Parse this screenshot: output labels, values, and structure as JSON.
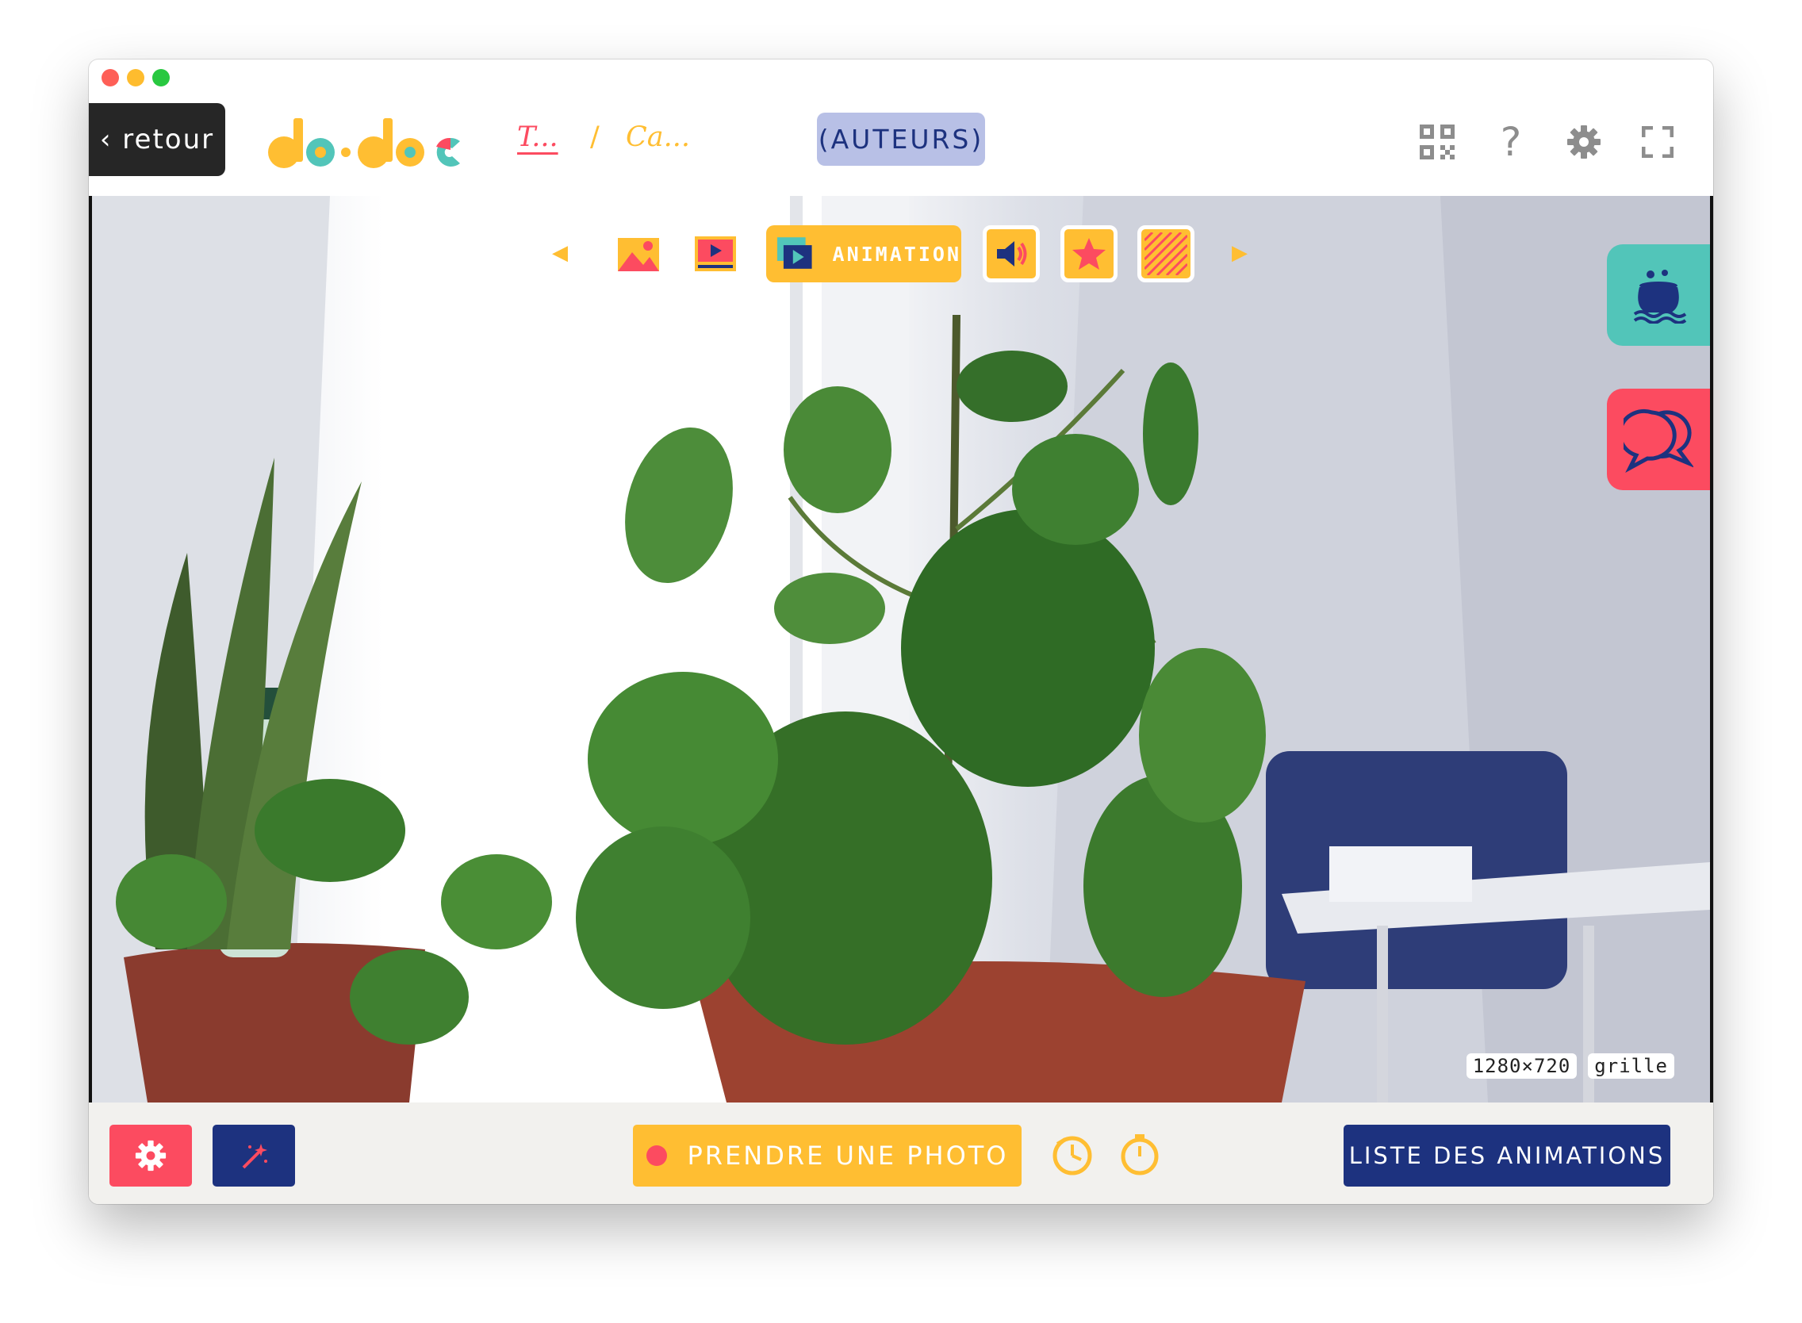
{
  "window": {
    "controls": [
      "close",
      "minimize",
      "zoom"
    ]
  },
  "header": {
    "back_label": "‹ retour",
    "logo_alt": "do•doc",
    "breadcrumb": {
      "project": "T...",
      "separator": "/",
      "module": "Ca..."
    },
    "authors_label": "(AUTEURS)",
    "icons": [
      "qr-code-icon",
      "help-icon",
      "settings-icon",
      "fullscreen-icon"
    ],
    "help_glyph": "?"
  },
  "capture": {
    "modes": [
      {
        "name": "photo",
        "icon": "image-icon"
      },
      {
        "name": "video",
        "icon": "video-icon"
      },
      {
        "name": "animation",
        "label": "ANIMATION",
        "icon": "animation-icon",
        "active": true
      },
      {
        "name": "audio",
        "icon": "speaker-icon"
      },
      {
        "name": "stopmotion",
        "icon": "star-icon"
      },
      {
        "name": "other",
        "icon": "stripes-icon"
      }
    ],
    "resolution_badge": "1280×720",
    "grid_badge": "grille"
  },
  "side_tabs": [
    {
      "name": "recipes",
      "icon": "cauldron-icon",
      "color": "#52c5b9"
    },
    {
      "name": "chat",
      "icon": "chat-bubbles-icon",
      "color": "#fc4b60"
    }
  ],
  "bottom": {
    "take_photo_label": "PRENDRE UNE PHOTO",
    "list_label": "LISTE DES ANIMATIONS"
  },
  "colors": {
    "red": "#fc4b60",
    "yellow": "#ffbe32",
    "navy": "#1d327f",
    "teal": "#52c5b9",
    "lavender": "#b8c0e6"
  }
}
